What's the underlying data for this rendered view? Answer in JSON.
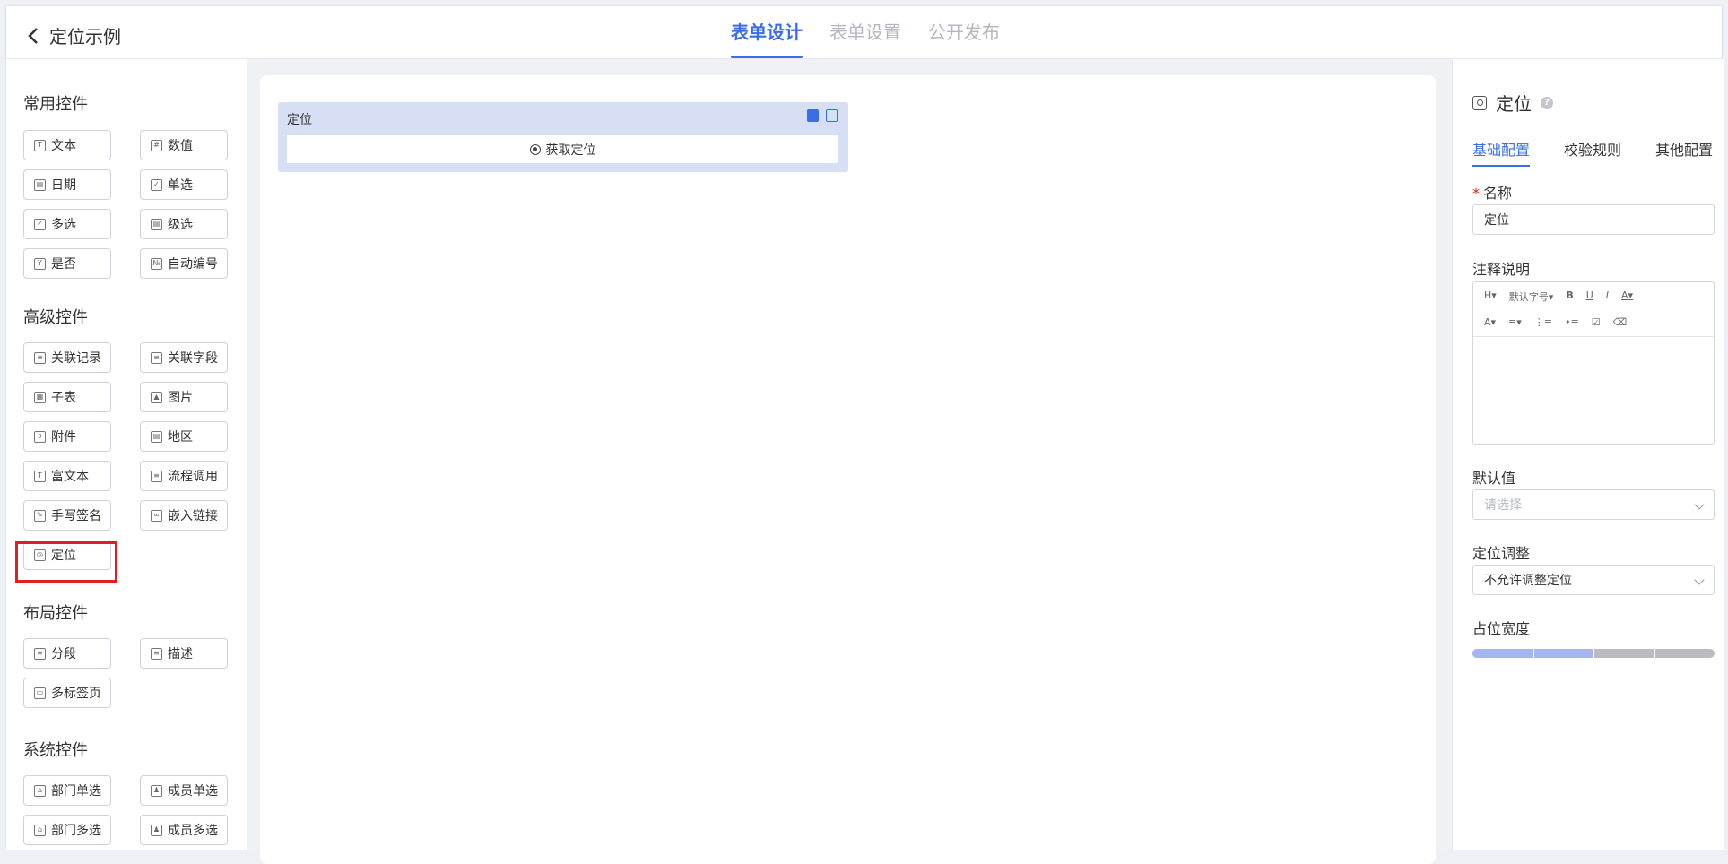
{
  "header": {
    "title": "定位示例",
    "tabs": [
      {
        "label": "表单设计",
        "active": true
      },
      {
        "label": "表单设置",
        "active": false
      },
      {
        "label": "公开发布",
        "active": false
      }
    ]
  },
  "sidebar": {
    "sections": [
      {
        "title": "常用控件",
        "items": [
          "文本",
          "数值",
          "日期",
          "单选",
          "多选",
          "级选",
          "是否",
          "自动编号"
        ]
      },
      {
        "title": "高级控件",
        "items": [
          "关联记录",
          "关联字段",
          "子表",
          "图片",
          "附件",
          "地区",
          "富文本",
          "流程调用",
          "手写签名",
          "嵌入链接",
          "定位"
        ]
      },
      {
        "title": "布局控件",
        "items": [
          "分段",
          "描述",
          "多标签页"
        ]
      },
      {
        "title": "系统控件",
        "items": [
          "部门单选",
          "成员单选",
          "部门多选",
          "成员多选"
        ]
      }
    ],
    "highlighted": "定位"
  },
  "canvas": {
    "field_label": "定位",
    "button_label": "获取定位"
  },
  "props": {
    "title": "定位",
    "tabs": [
      "基础配置",
      "校验规则",
      "其他配置"
    ],
    "name_label": "名称",
    "name_value": "定位",
    "note_label": "注释说明",
    "toolbar": {
      "heading": "H▾",
      "font_size": "默认字号▾",
      "bold": "B",
      "underline": "U",
      "italic": "I",
      "font_color": "A▾",
      "bg_color": "A▾",
      "align": "≡▾",
      "ol": "⋮≡",
      "ul": "•≡",
      "todo": "☑",
      "clear": "⌫"
    },
    "default_label": "默认值",
    "default_placeholder": "请选择",
    "adjust_label": "定位调整",
    "adjust_value": "不允许调整定位",
    "width_label": "占位宽度",
    "width_fraction": 0.5,
    "accent": "#3a6ee8",
    "highlight_color": "#e02020"
  }
}
